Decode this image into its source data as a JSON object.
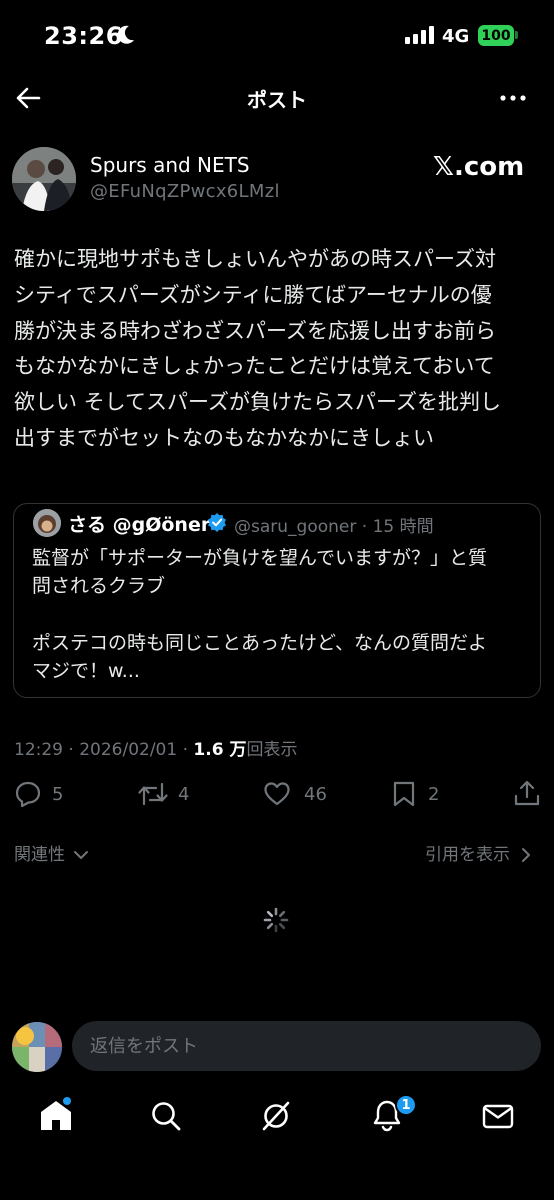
{
  "status_bar": {
    "time": "23:26",
    "network": "4G",
    "battery": "100"
  },
  "header": {
    "title": "ポスト"
  },
  "post": {
    "author_name": "Spurs and NETS",
    "author_handle": "@EFuNqZPwcx6LMzl",
    "source_label": "𝕏.com",
    "text": "確かに現地サポもきしょいんやがあの時スパーズ対\nシティでスパーズがシティに勝てばアーセナルの優\n勝が決まる時わざわざスパーズを応援し出すお前ら\nもなかなかにきしょかったことだけは覚えておいて\n欲しい そしてスパーズが負けたらスパーズを批判し\n出すまでがセットなのもなかなかにきしょい",
    "timestamp": "12:29 · 2026/02/01 · ",
    "views": "1.6 万",
    "views_suffix": "回表示"
  },
  "quote": {
    "name": "さる @gØöner",
    "handle": "@saru_gooner · 15 時間",
    "text": "監督が「サポーターが負けを望んでいますが？」と質\n問されるクラブ\n\nポステコの時も同じことあったけど、なんの質問だよ\nマジで！w..."
  },
  "actions": {
    "replies": "5",
    "reposts": "4",
    "likes": "46",
    "bookmarks": "2"
  },
  "related": {
    "left_label": "関連性",
    "right_label": "引用を表示"
  },
  "reply": {
    "placeholder": "返信をポスト"
  },
  "tabbar": {
    "notifications_badge": "1"
  },
  "colors": {
    "background": "#000000",
    "accent": "#1d9bf0",
    "muted": "#71767b",
    "battery": "#30d158"
  }
}
